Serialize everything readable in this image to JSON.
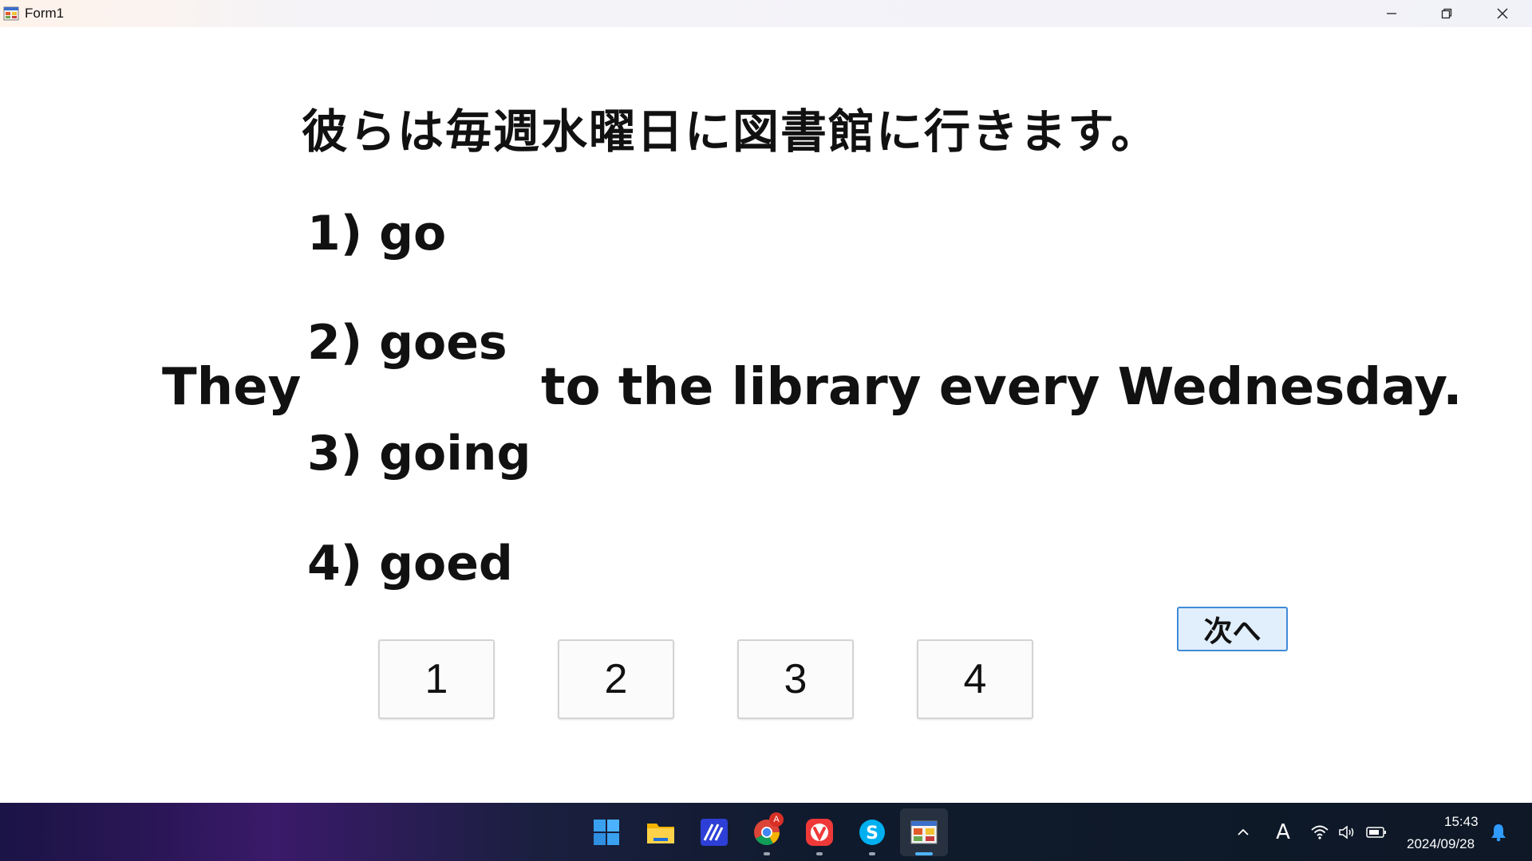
{
  "window": {
    "title": "Form1"
  },
  "question": {
    "japanese": "彼らは毎週水曜日に図書館に行きます。",
    "sentence_start": "They",
    "sentence_end": "to the library every Wednesday.",
    "options": [
      {
        "number": "1)",
        "text": "go"
      },
      {
        "number": "2)",
        "text": "goes"
      },
      {
        "number": "3)",
        "text": "going"
      },
      {
        "number": "4)",
        "text": "goed"
      }
    ]
  },
  "answer_buttons": [
    "1",
    "2",
    "3",
    "4"
  ],
  "next_button": "次へ",
  "taskbar": {
    "apps": [
      "start-icon",
      "file-explorer-icon",
      "app-a-icon",
      "chrome-icon",
      "vivaldi-icon",
      "skype-icon",
      "form-app-icon"
    ],
    "chrome_badge": "A",
    "ime_indicator": "A",
    "time": "15:43",
    "date": "2024/09/28"
  },
  "colors": {
    "next_button_border": "#3f8bd8",
    "next_button_bg": "#e1eefb",
    "taskbar_active": "#4fb3ff"
  }
}
